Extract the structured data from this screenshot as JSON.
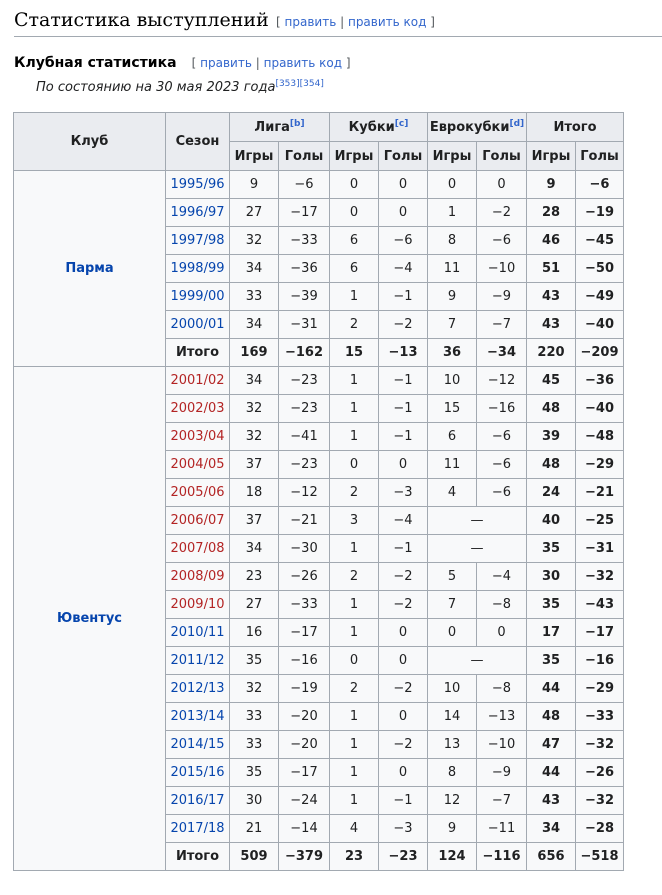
{
  "section": {
    "title": "Статистика выступлений",
    "edit_label": "править",
    "edit_code_label": "править код",
    "separator": "|",
    "open_bracket": "[",
    "close_bracket": "]"
  },
  "subsection": {
    "title": "Клубная статистика",
    "note": "По состоянию на 30 мая 2023 года",
    "refs": [
      "[353]",
      "[354]"
    ]
  },
  "table": {
    "headers": {
      "club": "Клуб",
      "season": "Сезон",
      "groups": [
        {
          "label": "Лига",
          "ref": "[b]"
        },
        {
          "label": "Кубки",
          "ref": "[c]"
        },
        {
          "label": "Еврокубки",
          "ref": "[d]"
        },
        {
          "label": "Итого",
          "ref": ""
        }
      ],
      "sub": [
        "Игры",
        "Голы"
      ]
    },
    "clubs": [
      {
        "name": "Парма",
        "rows": [
          {
            "season": "1995/96",
            "link_color": "blue",
            "cells": [
              "9",
              "−6",
              "0",
              "0",
              "0",
              "0",
              "9",
              "−6"
            ]
          },
          {
            "season": "1996/97",
            "link_color": "blue",
            "cells": [
              "27",
              "−17",
              "0",
              "0",
              "1",
              "−2",
              "28",
              "−19"
            ]
          },
          {
            "season": "1997/98",
            "link_color": "blue",
            "cells": [
              "32",
              "−33",
              "6",
              "−6",
              "8",
              "−6",
              "46",
              "−45"
            ]
          },
          {
            "season": "1998/99",
            "link_color": "blue",
            "cells": [
              "34",
              "−36",
              "6",
              "−4",
              "11",
              "−10",
              "51",
              "−50"
            ]
          },
          {
            "season": "1999/00",
            "link_color": "blue",
            "cells": [
              "33",
              "−39",
              "1",
              "−1",
              "9",
              "−9",
              "43",
              "−49"
            ]
          },
          {
            "season": "2000/01",
            "link_color": "blue",
            "cells": [
              "34",
              "−31",
              "2",
              "−2",
              "7",
              "−7",
              "43",
              "−40"
            ]
          }
        ],
        "total": {
          "label": "Итого",
          "cells": [
            "169",
            "−162",
            "15",
            "−13",
            "36",
            "−34",
            "220",
            "−209"
          ]
        }
      },
      {
        "name": "Ювентус",
        "rows": [
          {
            "season": "2001/02",
            "link_color": "red",
            "cells": [
              "34",
              "−23",
              "1",
              "−1",
              "10",
              "−12",
              "45",
              "−36"
            ]
          },
          {
            "season": "2002/03",
            "link_color": "red",
            "cells": [
              "32",
              "−23",
              "1",
              "−1",
              "15",
              "−16",
              "48",
              "−40"
            ]
          },
          {
            "season": "2003/04",
            "link_color": "red",
            "cells": [
              "32",
              "−41",
              "1",
              "−1",
              "6",
              "−6",
              "39",
              "−48"
            ]
          },
          {
            "season": "2004/05",
            "link_color": "red",
            "cells": [
              "37",
              "−23",
              "0",
              "0",
              "11",
              "−6",
              "48",
              "−29"
            ]
          },
          {
            "season": "2005/06",
            "link_color": "red",
            "cells": [
              "18",
              "−12",
              "2",
              "−3",
              "4",
              "−6",
              "24",
              "−21"
            ]
          },
          {
            "season": "2006/07",
            "link_color": "red",
            "cells": [
              "37",
              "−21",
              "3",
              "−4",
              "—",
              "",
              "40",
              "−25"
            ]
          },
          {
            "season": "2007/08",
            "link_color": "red",
            "cells": [
              "34",
              "−30",
              "1",
              "−1",
              "—",
              "",
              "35",
              "−31"
            ]
          },
          {
            "season": "2008/09",
            "link_color": "red",
            "cells": [
              "23",
              "−26",
              "2",
              "−2",
              "5",
              "−4",
              "30",
              "−32"
            ]
          },
          {
            "season": "2009/10",
            "link_color": "red",
            "cells": [
              "27",
              "−33",
              "1",
              "−2",
              "7",
              "−8",
              "35",
              "−43"
            ]
          },
          {
            "season": "2010/11",
            "link_color": "blue",
            "cells": [
              "16",
              "−17",
              "1",
              "0",
              "0",
              "0",
              "17",
              "−17"
            ]
          },
          {
            "season": "2011/12",
            "link_color": "blue",
            "cells": [
              "35",
              "−16",
              "0",
              "0",
              "—",
              "",
              "35",
              "−16"
            ]
          },
          {
            "season": "2012/13",
            "link_color": "blue",
            "cells": [
              "32",
              "−19",
              "2",
              "−2",
              "10",
              "−8",
              "44",
              "−29"
            ]
          },
          {
            "season": "2013/14",
            "link_color": "blue",
            "cells": [
              "33",
              "−20",
              "1",
              "0",
              "14",
              "−13",
              "48",
              "−33"
            ]
          },
          {
            "season": "2014/15",
            "link_color": "blue",
            "cells": [
              "33",
              "−20",
              "1",
              "−2",
              "13",
              "−10",
              "47",
              "−32"
            ]
          },
          {
            "season": "2015/16",
            "link_color": "blue",
            "cells": [
              "35",
              "−17",
              "1",
              "0",
              "8",
              "−9",
              "44",
              "−26"
            ]
          },
          {
            "season": "2016/17",
            "link_color": "blue",
            "cells": [
              "30",
              "−24",
              "1",
              "−1",
              "12",
              "−7",
              "43",
              "−32"
            ]
          },
          {
            "season": "2017/18",
            "link_color": "blue",
            "cells": [
              "21",
              "−14",
              "4",
              "−3",
              "9",
              "−11",
              "34",
              "−28"
            ]
          }
        ],
        "total": {
          "label": "Итого",
          "cells": [
            "509",
            "−379",
            "23",
            "−23",
            "124",
            "−116",
            "656",
            "−518"
          ]
        }
      }
    ]
  }
}
